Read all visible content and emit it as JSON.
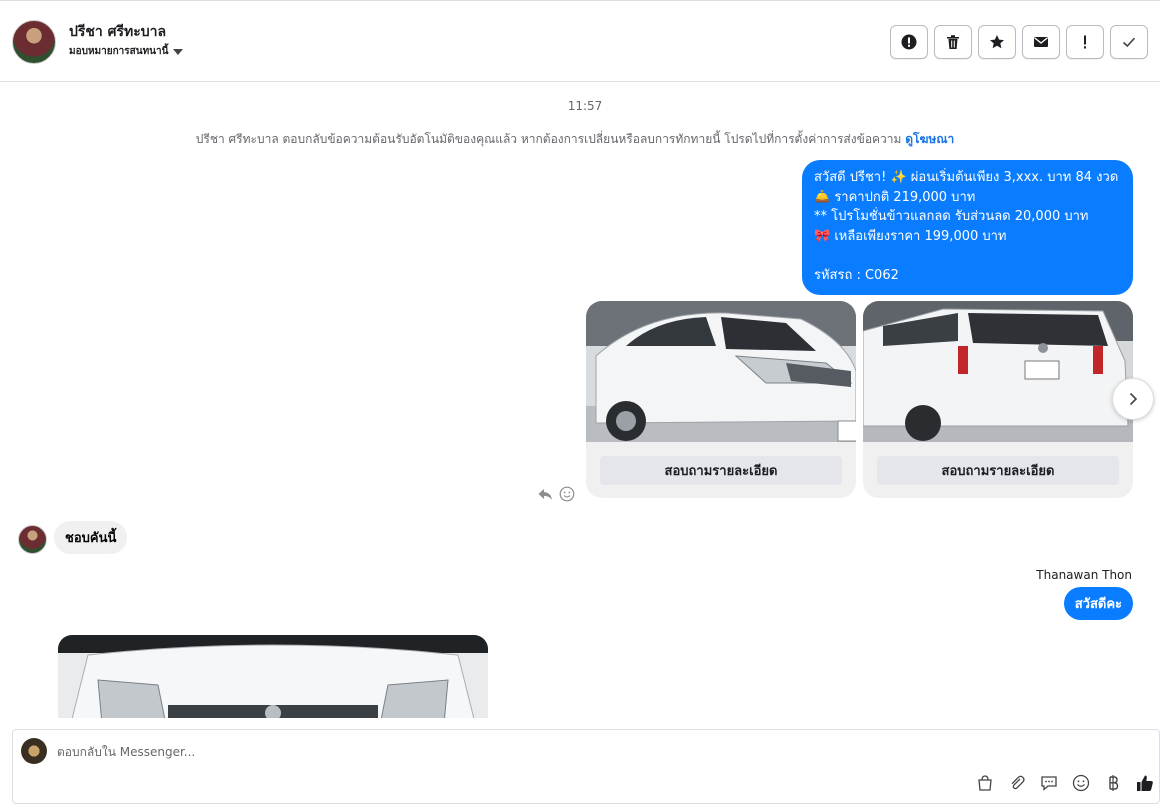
{
  "header": {
    "name": "ปรีชา ศรีทะบาล",
    "assign_label": "มอบหมายการสนทนานี้"
  },
  "chat": {
    "time": "11:57",
    "notice_text": "ปรีชา ศรีทะบาล ตอบกลับข้อความต้อนรับอัตโนมัติของคุณแล้ว หากต้องการเปลี่ยนหรือลบการทักทายนี้ โปรดไปที่การตั้งค่าการส่งข้อความ",
    "notice_link": "ดูโฆษณา",
    "bubble_lines": [
      "สวัสดี ปรีชา! ✨  ผ่อนเริ่มต้นเพียง 3,xxx. บาท 84 งวด",
      "🛎️ ราคาปกติ 219,000 บาท",
      "** โปรโมชั่นข้าวแลกลด รับส่วนลด 20,000 บาท",
      "🎀  เหลือเพียงราคา 199,000 บาท",
      "",
      " รหัสรถ : C062"
    ],
    "cards": [
      {
        "button": "สอบถามรายละเอียด"
      },
      {
        "button": "สอบถามรายละเอียด"
      }
    ],
    "incoming_text": "ชอบคันนี้",
    "sender_name": "Thanawan Thon",
    "reply_text": "สวัสดีคะ"
  },
  "composer": {
    "placeholder": "ตอบกลับใน Messenger..."
  },
  "colors": {
    "accent": "#0a7cff",
    "incoming_bubble": "#f0f0f0"
  },
  "icons": [
    "alert-icon",
    "trash-icon",
    "star-icon",
    "mail-icon",
    "exclamation-icon",
    "check-icon",
    "reply-icon",
    "smile-icon",
    "chevron-right-icon",
    "shop-icon",
    "attach-icon",
    "saved-reply-icon",
    "emoji-icon",
    "baht-icon",
    "like-icon"
  ]
}
